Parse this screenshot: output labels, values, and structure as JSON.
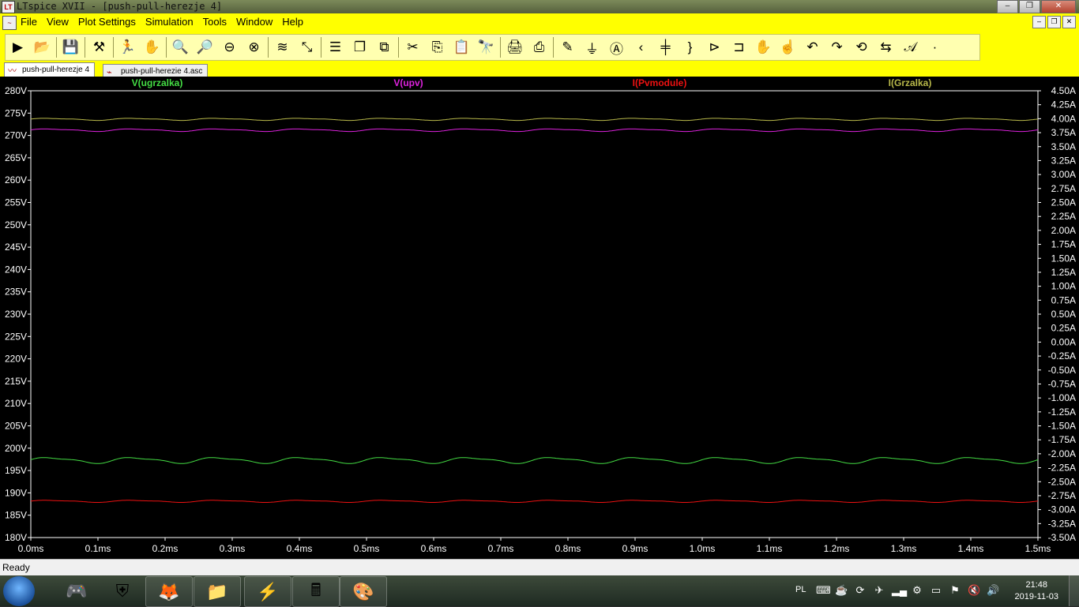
{
  "window": {
    "title": "LTspice XVII - [push-pull-herezje 4]",
    "app_icon": "ltspice-icon",
    "minimize": "–",
    "maximize": "❐",
    "close": "✕"
  },
  "menu": {
    "items": [
      "File",
      "View",
      "Plot Settings",
      "Simulation",
      "Tools",
      "Window",
      "Help"
    ],
    "mdi_controls": [
      "–",
      "❐",
      "✕"
    ]
  },
  "toolbar": {
    "icons": [
      "run-icon",
      "open-icon",
      "save-icon",
      "control-panel-icon",
      "run-arrow-icon",
      "pan-icon",
      "zoom-in-icon",
      "zoom-area-icon",
      "zoom-out-icon",
      "zoom-cancel-icon",
      "autorange-icon",
      "zoom-fit-icon",
      "tile-horizontal-icon",
      "cascade-icon",
      "tile-vertical-icon",
      "cut-icon",
      "copy-icon",
      "paste-icon",
      "find-icon",
      "print-icon",
      "print-setup-icon",
      "draw-wire-icon",
      "ground-icon",
      "label-net-icon",
      "resistor-icon",
      "capacitor-icon",
      "inductor-icon",
      "diode-icon",
      "component-icon",
      "move-icon",
      "drag-icon",
      "undo-icon",
      "redo-icon",
      "rotate-icon",
      "mirror-icon",
      "text-icon",
      "spice-directive-icon"
    ]
  },
  "tabs": [
    {
      "label": "push-pull-herezje 4",
      "icon": "waveform-icon",
      "active": true
    },
    {
      "label": "push-pull-herezie 4.asc",
      "icon": "schematic-icon",
      "active": false
    }
  ],
  "traces": [
    {
      "label": "V(ugrzalka)",
      "color": "#44dd44"
    },
    {
      "label": "V(upv)",
      "color": "#dd22dd"
    },
    {
      "label": "I(Pvmodule)",
      "color": "#ee1111"
    },
    {
      "label": "I(Grzalka)",
      "color": "#b8b84a"
    }
  ],
  "chart_data": {
    "type": "line",
    "xlabel": "",
    "ylabel_left": "",
    "ylabel_right": "",
    "xlim": [
      0,
      1.5
    ],
    "ylim_left": [
      180,
      280
    ],
    "ylim_right": [
      -3.5,
      4.5
    ],
    "x_ticks": [
      "0.0ms",
      "0.1ms",
      "0.2ms",
      "0.3ms",
      "0.4ms",
      "0.5ms",
      "0.6ms",
      "0.7ms",
      "0.8ms",
      "0.9ms",
      "1.0ms",
      "1.1ms",
      "1.2ms",
      "1.3ms",
      "1.4ms",
      "1.5ms"
    ],
    "y_ticks_left": [
      "280V",
      "275V",
      "270V",
      "265V",
      "260V",
      "255V",
      "250V",
      "245V",
      "240V",
      "235V",
      "230V",
      "225V",
      "220V",
      "215V",
      "210V",
      "205V",
      "200V",
      "195V",
      "190V",
      "185V",
      "180V"
    ],
    "y_ticks_right": [
      "4.50A",
      "4.25A",
      "4.00A",
      "3.75A",
      "3.50A",
      "3.25A",
      "3.00A",
      "2.75A",
      "2.50A",
      "2.25A",
      "2.00A",
      "1.75A",
      "1.50A",
      "1.25A",
      "1.00A",
      "0.75A",
      "0.50A",
      "0.25A",
      "0.00A",
      "-0.25A",
      "-0.50A",
      "-0.75A",
      "-1.00A",
      "-1.25A",
      "-1.50A",
      "-1.75A",
      "-2.00A",
      "-2.25A",
      "-2.50A",
      "-2.75A",
      "-3.00A",
      "-3.25A",
      "-3.50A"
    ],
    "series": [
      {
        "name": "V(ugrzalka)",
        "axis": "left",
        "mean": 197.3,
        "ripple_amplitude": 0.7,
        "period_ms": 0.125,
        "color": "#44dd44"
      },
      {
        "name": "V(upv)",
        "axis": "left",
        "mean": 271.2,
        "ripple_amplitude": 0.3,
        "period_ms": 0.125,
        "color": "#dd22dd"
      },
      {
        "name": "I(Pvmodule)",
        "axis": "right",
        "mean": -2.85,
        "ripple_amplitude": 0.02,
        "period_ms": 0.125,
        "color": "#ee1111"
      },
      {
        "name": "I(Grzalka)",
        "axis": "right",
        "mean": 3.99,
        "ripple_amplitude": 0.02,
        "period_ms": 0.125,
        "color": "#b8b84a"
      }
    ],
    "grid": false
  },
  "status": {
    "text": "Ready"
  },
  "taskbar": {
    "apps": [
      "world-of-tanks-icon",
      "firefox-icon",
      "file-explorer-icon",
      "ltspice-icon",
      "calculator-icon",
      "paint-icon"
    ],
    "language": "PL",
    "tray_icons": [
      "keyboard-icon",
      "java-icon",
      "sync-icon",
      "network-icon",
      "signal-icon",
      "tools-icon",
      "monitor-icon",
      "flag-icon",
      "volume-muted-icon",
      "volume-icon"
    ],
    "time": "21:48",
    "date": "2019-11-03"
  }
}
